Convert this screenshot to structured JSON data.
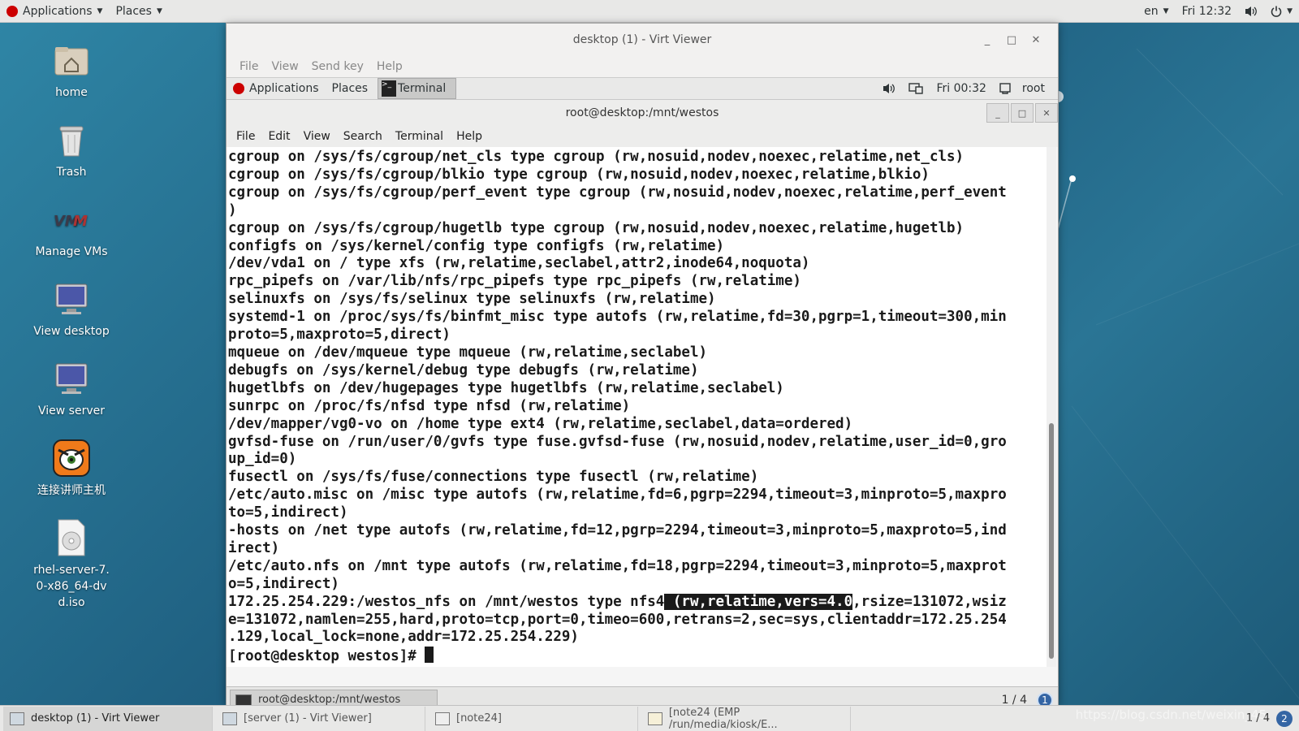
{
  "host_top": {
    "applications": "Applications",
    "places": "Places",
    "lang": "en",
    "clock": "Fri 12:32"
  },
  "desktop_icons": [
    {
      "label": "home"
    },
    {
      "label": "Trash"
    },
    {
      "label": "Manage VMs"
    },
    {
      "label": "View desktop"
    },
    {
      "label": "View server"
    },
    {
      "label": "连接讲师主机"
    },
    {
      "label": "rhel-server-7.0-x86_64-dvd.iso"
    }
  ],
  "virt_viewer": {
    "title": "desktop (1) - Virt Viewer",
    "menu": [
      "File",
      "View",
      "Send key",
      "Help"
    ]
  },
  "guest_top": {
    "applications": "Applications",
    "places": "Places",
    "terminal_task": "Terminal",
    "clock": "Fri 00:32",
    "user": "root"
  },
  "terminal": {
    "title": "root@desktop:/mnt/westos",
    "menu": [
      "File",
      "Edit",
      "View",
      "Search",
      "Terminal",
      "Help"
    ],
    "lines": [
      "cgroup on /sys/fs/cgroup/net_cls type cgroup (rw,nosuid,nodev,noexec,relatime,net_cls)",
      "cgroup on /sys/fs/cgroup/blkio type cgroup (rw,nosuid,nodev,noexec,relatime,blkio)",
      "cgroup on /sys/fs/cgroup/perf_event type cgroup (rw,nosuid,nodev,noexec,relatime,perf_event",
      ")",
      "cgroup on /sys/fs/cgroup/hugetlb type cgroup (rw,nosuid,nodev,noexec,relatime,hugetlb)",
      "configfs on /sys/kernel/config type configfs (rw,relatime)",
      "/dev/vda1 on / type xfs (rw,relatime,seclabel,attr2,inode64,noquota)",
      "rpc_pipefs on /var/lib/nfs/rpc_pipefs type rpc_pipefs (rw,relatime)",
      "selinuxfs on /sys/fs/selinux type selinuxfs (rw,relatime)",
      "systemd-1 on /proc/sys/fs/binfmt_misc type autofs (rw,relatime,fd=30,pgrp=1,timeout=300,min",
      "proto=5,maxproto=5,direct)",
      "mqueue on /dev/mqueue type mqueue (rw,relatime,seclabel)",
      "debugfs on /sys/kernel/debug type debugfs (rw,relatime)",
      "hugetlbfs on /dev/hugepages type hugetlbfs (rw,relatime,seclabel)",
      "sunrpc on /proc/fs/nfsd type nfsd (rw,relatime)",
      "/dev/mapper/vg0-vo on /home type ext4 (rw,relatime,seclabel,data=ordered)",
      "gvfsd-fuse on /run/user/0/gvfs type fuse.gvfsd-fuse (rw,nosuid,nodev,relatime,user_id=0,gro",
      "up_id=0)",
      "fusectl on /sys/fs/fuse/connections type fusectl (rw,relatime)",
      "/etc/auto.misc on /misc type autofs (rw,relatime,fd=6,pgrp=2294,timeout=3,minproto=5,maxpro",
      "to=5,indirect)",
      "-hosts on /net type autofs (rw,relatime,fd=12,pgrp=2294,timeout=3,minproto=5,maxproto=5,ind",
      "irect)",
      "/etc/auto.nfs on /mnt type autofs (rw,relatime,fd=18,pgrp=2294,timeout=3,minproto=5,maxprot",
      "o=5,indirect)"
    ],
    "nfs_line_pre": "172.25.254.229:/westos_nfs on /mnt/westos type nfs4",
    "nfs_line_sel": " (rw,relatime,vers=4.0",
    "nfs_line_post": ",rsize=131072,wsiz",
    "tail_lines": [
      "e=131072,namlen=255,hard,proto=tcp,port=0,timeo=600,retrans=2,sec=sys,clientaddr=172.25.254",
      ".129,local_lock=none,addr=172.25.254.229)"
    ],
    "prompt": "[root@desktop westos]# "
  },
  "guest_bottom": {
    "task": "root@desktop:/mnt/westos",
    "pager": "1 / 4",
    "badge": "1"
  },
  "host_bottom": {
    "tasks": [
      "desktop (1) - Virt Viewer",
      "[server (1) - Virt Viewer]",
      "[note24]",
      "[note24 (EMP /run/media/kiosk/E..."
    ],
    "pager": "1 / 4",
    "badge": "2",
    "watermark": "https://blog.csdn.net/weixin_45"
  }
}
